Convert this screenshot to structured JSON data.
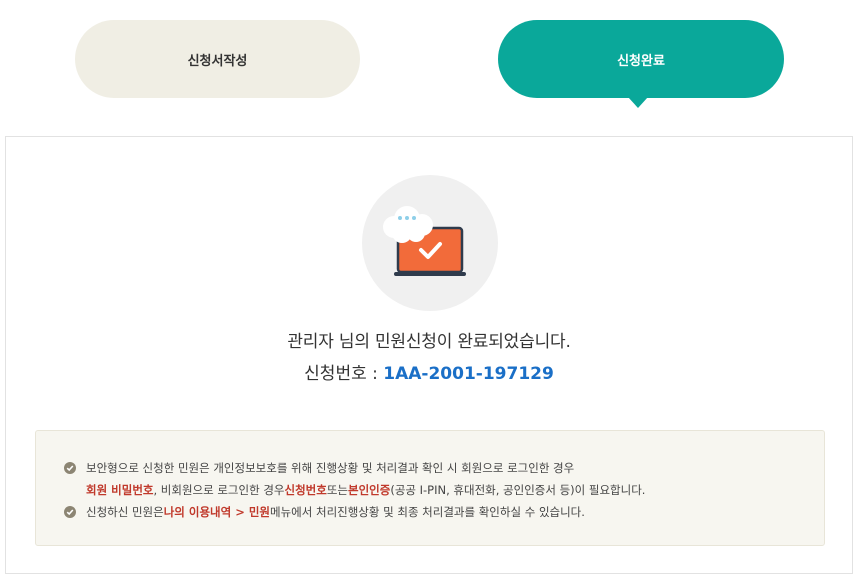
{
  "steps": [
    {
      "label": "신청서작성",
      "active": false
    },
    {
      "label": "신청완료",
      "active": true
    }
  ],
  "result": {
    "user_name": "관리자",
    "message_suffix": " 님의 민원신청이 완료되었습니다.",
    "request_number_label": "신청번호 : ",
    "request_number": "1AA-2001-197129"
  },
  "notice": {
    "line1": "보안형으로 신청한 민원은 개인정보보호를 위해 진행상황 및 처리결과 확인 시 회원으로 로그인한 경우",
    "line2_hl1": "회원 비밀번호",
    "line2_t1": ", 비회원으로 로그인한 경우 ",
    "line2_hl2": "신청번호",
    "line2_t2": " 또는 ",
    "line2_hl3": "본인인증",
    "line2_t3": " (공공 I-PIN, 휴대전화, 공인인증서 등)이 필요합니다.",
    "line3_t1": "신청하신 민원은 ",
    "line3_hl": "나의 이용내역 > 민원",
    "line3_t2": " 메뉴에서 처리진행상황 및 최종 처리결과를 확인하실 수 있습니다."
  },
  "colors": {
    "active_step": "#0aa89a",
    "inactive_step": "#f0eee4",
    "request_number": "#1a6fc7",
    "highlight": "#c0392b",
    "laptop": "#f26b3a"
  }
}
